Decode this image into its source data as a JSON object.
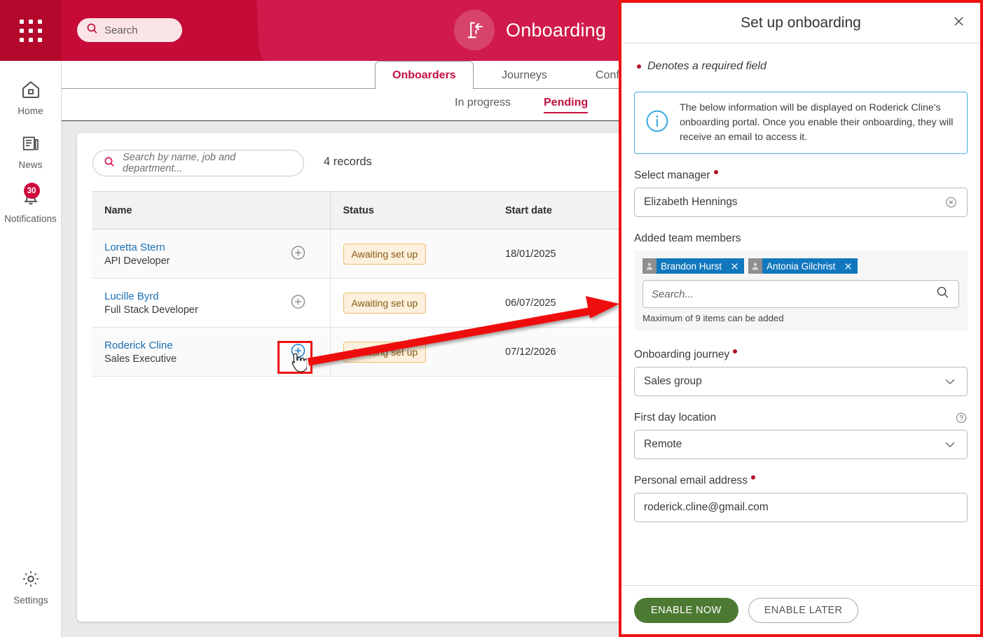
{
  "app": {
    "logo_icon": "app-grid-icon",
    "header_search_label": "Search",
    "header_title": "Onboarding",
    "header_icon": "onboarding-door-icon",
    "brand_color": "#c60b38",
    "accent_color": "#c2123f"
  },
  "sidebar": {
    "items": [
      {
        "label": "Home",
        "icon": "home-icon",
        "badge": ""
      },
      {
        "label": "News",
        "icon": "news-icon",
        "badge": ""
      },
      {
        "label": "Notifications",
        "icon": "bell-icon",
        "badge": "30"
      }
    ],
    "settings": {
      "label": "Settings",
      "icon": "gear-icon"
    }
  },
  "tabs": [
    {
      "label": "Onboarders",
      "active": true
    },
    {
      "label": "Journeys",
      "active": false
    },
    {
      "label": "Config",
      "active": false
    }
  ],
  "subtabs": [
    {
      "label": "In progress",
      "active": false
    },
    {
      "label": "Pending",
      "active": true
    }
  ],
  "toolbar": {
    "search_placeholder": "Search by name, job and department...",
    "search_icon": "search-icon",
    "records_count": "4 records"
  },
  "table": {
    "columns": [
      "Name",
      "Status",
      "Start date"
    ],
    "rows": [
      {
        "name": "Loretta Stern",
        "job": "API Developer",
        "add_icon": "plus-circle-icon",
        "status": "Awaiting set up",
        "start_date": "18/01/2025"
      },
      {
        "name": "Lucille Byrd",
        "job": "Full Stack Developer",
        "add_icon": "plus-circle-icon",
        "status": "Awaiting set up",
        "start_date": "06/07/2025"
      },
      {
        "name": "Roderick Cline",
        "job": "Sales Executive",
        "add_icon": "plus-circle-icon",
        "status": "Awaiting set up",
        "start_date": "07/12/2026"
      }
    ]
  },
  "annotation": {
    "highlight_color": "#ee1111",
    "arrow_color": "#ee1111",
    "cursor_icon": "pointing-hand-cursor"
  },
  "modal": {
    "title": "Set up onboarding",
    "close_icon": "close-icon",
    "required_note": "Denotes a required field",
    "info": {
      "icon": "info-icon",
      "text": "The below information will be displayed on Roderick Cline's onboarding portal. Once you enable their onboarding, they will receive an email to access it.",
      "border_color": "#4daee0"
    },
    "fields": {
      "manager": {
        "label": "Select manager",
        "required": true,
        "value": "Elizabeth Hennings",
        "clear_icon": "clear-circle-icon"
      },
      "team_members": {
        "label": "Added team members",
        "required": false,
        "chips": [
          {
            "name": "Brandon Hurst",
            "avatar_icon": "user-avatar-icon",
            "remove_icon": "close-icon"
          },
          {
            "name": "Antonia Gilchrist",
            "avatar_icon": "user-avatar-icon",
            "remove_icon": "close-icon"
          }
        ],
        "search_placeholder": "Search...",
        "search_icon": "search-icon",
        "hint": "Maximum of 9 items can be added",
        "chip_color": "#1278be"
      },
      "journey": {
        "label": "Onboarding journey",
        "required": true,
        "value": "Sales group",
        "chevron_icon": "chevron-down-icon"
      },
      "first_day_location": {
        "label": "First day location",
        "required": false,
        "value": "Remote",
        "chevron_icon": "chevron-down-icon",
        "help_icon": "help-circle-icon"
      },
      "personal_email": {
        "label": "Personal email address",
        "required": true,
        "value": "roderick.cline@gmail.com"
      }
    },
    "footer": {
      "primary_label": "ENABLE NOW",
      "secondary_label": "ENABLE LATER",
      "primary_color": "#4c7a33"
    }
  }
}
